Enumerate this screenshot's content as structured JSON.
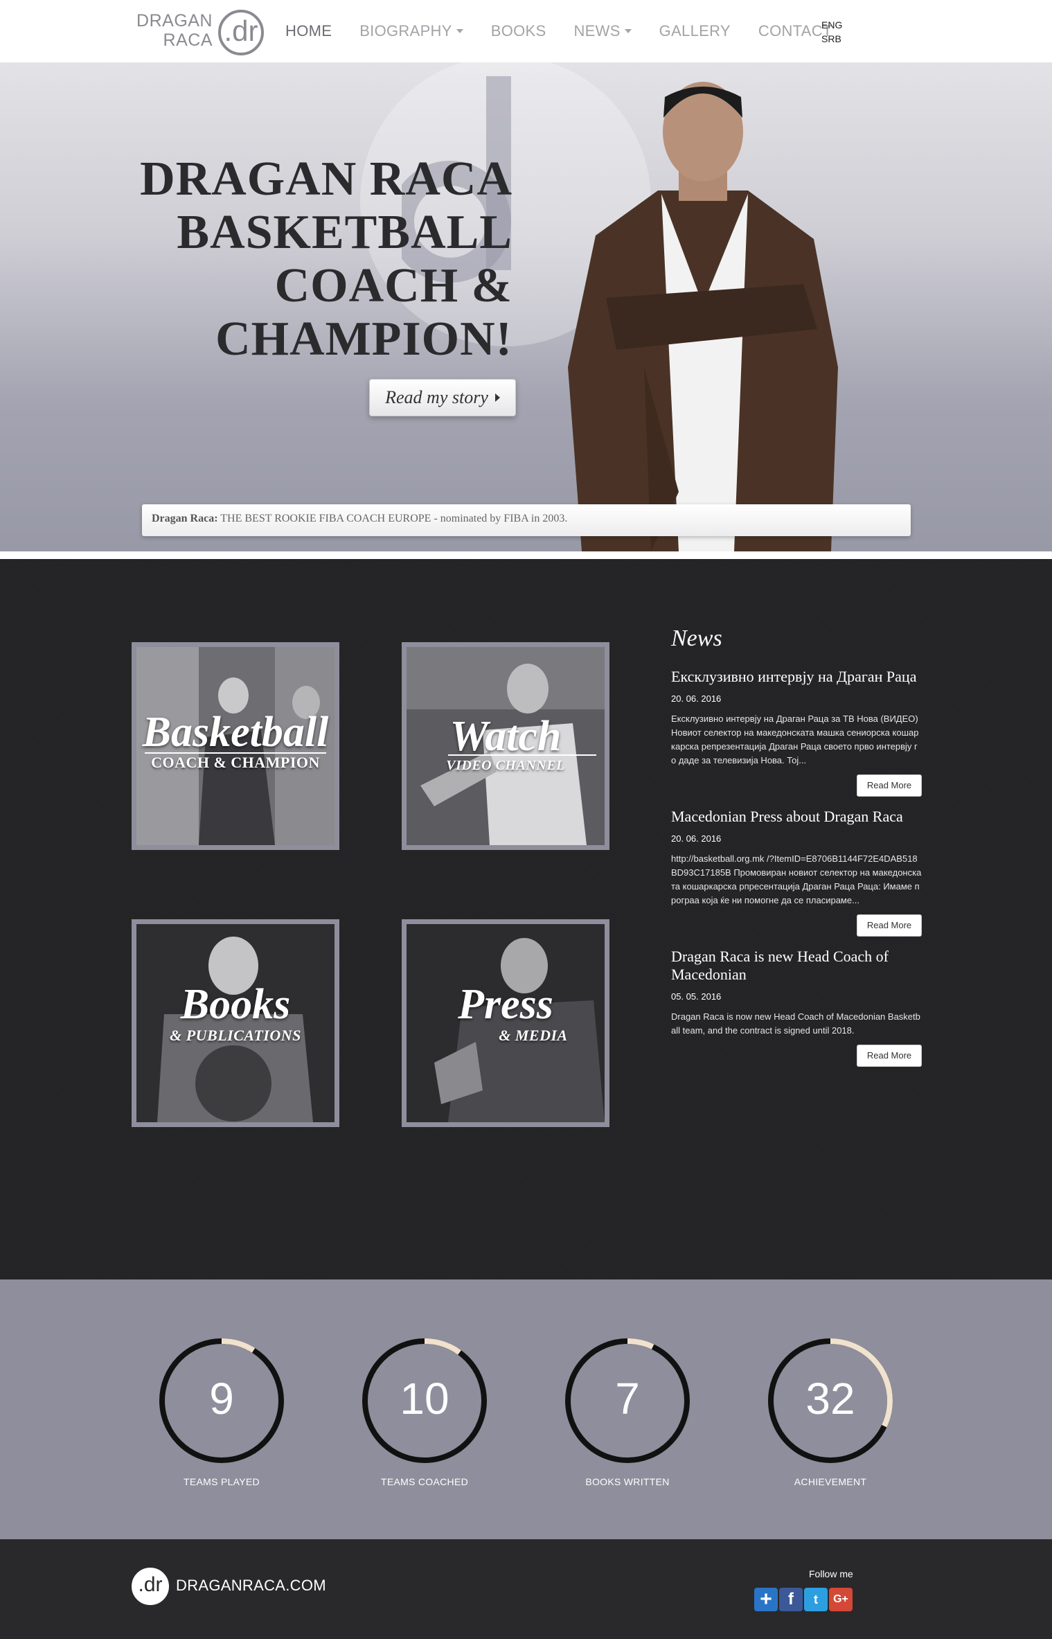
{
  "brand": {
    "line1": "DRAGAN",
    "line2": "RACA",
    "mark": ".dr"
  },
  "nav": [
    {
      "label": "HOME",
      "active": true,
      "dropdown": false
    },
    {
      "label": "BIOGRAPHY",
      "active": false,
      "dropdown": true
    },
    {
      "label": "BOOKS",
      "active": false,
      "dropdown": false
    },
    {
      "label": "NEWS",
      "active": false,
      "dropdown": true
    },
    {
      "label": "GALLERY",
      "active": false,
      "dropdown": false
    },
    {
      "label": "CONTACT",
      "active": false,
      "dropdown": false
    }
  ],
  "languages": [
    "ENG",
    "SRB"
  ],
  "hero": {
    "title_lines": [
      "DRAGAN RACA",
      "BASKETBALL",
      "COACH &",
      "CHAMPION!"
    ],
    "button": "Read my story",
    "caption_bold": "Dragan Raca:",
    "caption_text": "THE BEST ROOKIE FIBA COACH EUROPE - nominated by FIBA in 2003."
  },
  "tiles": [
    {
      "big": "Basketball",
      "small": "COACH & CHAMPION"
    },
    {
      "big": "Watch",
      "small": "VIDEO CHANNEL"
    },
    {
      "big": "Books",
      "small": "& PUBLICATIONS"
    },
    {
      "big": "Press",
      "small": "& MEDIA"
    }
  ],
  "news": {
    "heading": "News",
    "items": [
      {
        "title": "Ексклузивно интервју на Драган Раца",
        "date": "20. 06. 2016",
        "excerpt": "Ексклузивно интервју на Драган Раца за ТВ Нова (ВИДЕО)   Новиот селектор на македонската машка сениорска кошаркарска репрезентација Драган Раца своето прво интервју го даде за телевизија Нова. Тој...",
        "button": "Read More"
      },
      {
        "title": "Macedonian Press about Dragan Raca",
        "date": "20. 06. 2016",
        "excerpt": "http://basketball.org.mk /?ItemID=E8706B1144F72E4DAB518BD93C17185B Промовиран новиот селектор на македонската кошаркарска рпресентација Драган Раца   Раца: Имаме програа која ќе ни помогне да се пласираме...",
        "button": "Read More"
      },
      {
        "title": "Dragan Raca is new Head Coach of Macedonian",
        "date": "05. 05. 2016",
        "excerpt": "Dragan Raca is now new Head Coach of Macedonian Basketball team, and the contract is signed until 2018.",
        "button": "Read More"
      }
    ]
  },
  "stats": [
    {
      "value": "9",
      "label": "TEAMS PLAYED",
      "progress": 0.09
    },
    {
      "value": "10",
      "label": "TEAMS COACHED",
      "progress": 0.1
    },
    {
      "value": "7",
      "label": "BOOKS WRITTEN",
      "progress": 0.07
    },
    {
      "value": "32",
      "label": "ACHIEVEMENT",
      "progress": 0.32
    }
  ],
  "colors": {
    "ring_track": "#111111",
    "ring_progress": "#f1e2cd",
    "stats_bg": "#8e8e9c",
    "dark_bg": "#232325",
    "footer_bg": "#29292b"
  },
  "footer": {
    "mark": ".dr",
    "site": "DRAGANRACA.COM",
    "follow": "Follow me",
    "social": [
      {
        "icon": "share-plus-icon",
        "glyph": "+"
      },
      {
        "icon": "facebook-icon",
        "glyph": "f"
      },
      {
        "icon": "twitter-icon",
        "glyph": "t"
      },
      {
        "icon": "google-plus-icon",
        "glyph": "G+"
      }
    ]
  }
}
